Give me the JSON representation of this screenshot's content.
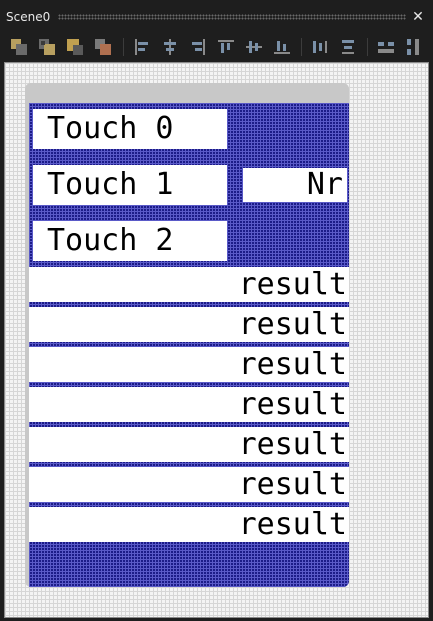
{
  "window": {
    "title": "Scene0",
    "close_glyph": "✕"
  },
  "toolbar": {
    "tools": [
      {
        "name": "bring-forward-icon"
      },
      {
        "name": "send-backward-icon"
      },
      {
        "name": "bring-to-front-icon"
      },
      {
        "name": "send-to-back-icon"
      },
      {
        "name": "align-left-icon"
      },
      {
        "name": "align-center-horizontal-icon"
      },
      {
        "name": "align-right-icon"
      },
      {
        "name": "align-top-icon"
      },
      {
        "name": "align-middle-vertical-icon"
      },
      {
        "name": "align-bottom-icon"
      },
      {
        "name": "distribute-horizontal-icon"
      },
      {
        "name": "distribute-vertical-icon"
      },
      {
        "name": "same-width-icon"
      },
      {
        "name": "same-height-icon"
      }
    ]
  },
  "scene": {
    "touch_buttons": [
      "Touch 0",
      "Touch 1",
      "Touch 2"
    ],
    "nr_label": "Nr",
    "results": [
      "result",
      "result",
      "result",
      "result",
      "result",
      "result",
      "result"
    ]
  },
  "colors": {
    "scene_fill": "#1c1c88",
    "scene_grid": "#5a5ac8",
    "panel_gray": "#c8c8c8",
    "canvas_bg": "#f4f4f4"
  }
}
